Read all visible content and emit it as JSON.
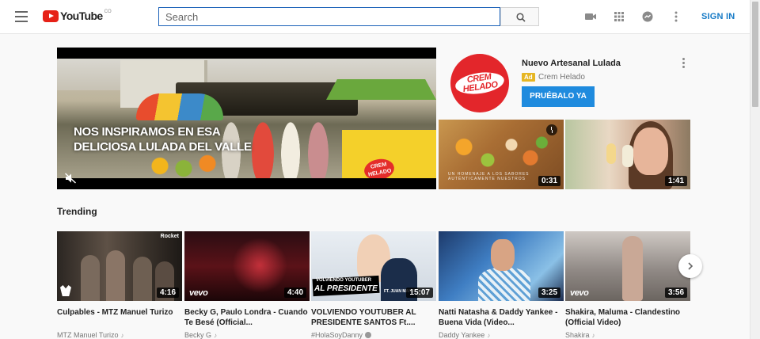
{
  "header": {
    "logo_text": "YouTube",
    "logo_region": "CO",
    "search_placeholder": "Search",
    "sign_in_label": "SIGN IN"
  },
  "hero": {
    "caption_line1": "NOS INSPIRAMOS EN ESA",
    "caption_line2": "DELICIOSA LULADA DEL VALLE",
    "brand_mark": "CREM HELADO"
  },
  "ad": {
    "logo_text_line1": "CREM",
    "logo_text_line2": "HELADO",
    "title": "Nuevo Artesanal Lulada",
    "badge": "Ad",
    "channel": "Crem Helado",
    "cta_label": "PRUÉBALO YA",
    "thumbs": [
      {
        "duration": "0:31",
        "subtext": "UN HOMENAJE A LOS SABORES AUTÉNTICAMENTE NUESTROS"
      },
      {
        "duration": "1:41"
      }
    ]
  },
  "trending": {
    "title": "Trending",
    "videos": [
      {
        "title": "Culpables - MTZ Manuel Turizo",
        "channel": "MTZ Manuel Turizo",
        "duration": "4:16",
        "music": "♪"
      },
      {
        "title": "Becky G, Paulo Londra - Cuando Te Besé (Official...",
        "channel": "Becky G",
        "duration": "4:40",
        "music": "♪"
      },
      {
        "title": "VOLVIENDO YOUTUBER AL PRESIDENTE SANTOS Ft....",
        "channel": "#HolaSoyDanny",
        "duration": "15:07",
        "banner_top": "VOLVIENDO YOUTUBER",
        "banner_main": "AL PRESIDENTE",
        "banner_ft": "FT. JUAN MANU"
      },
      {
        "title": "Natti Natasha & Daddy Yankee - Buena Vida (Video...",
        "channel": "Daddy Yankee",
        "duration": "3:25",
        "music": "♪"
      },
      {
        "title": "Shakira, Maluma - Clandestino (Official Video)",
        "channel": "Shakira",
        "duration": "3:56",
        "music": "♪"
      }
    ],
    "vevo_label": "vevo",
    "rocket_label": "Rocket"
  },
  "colors": {
    "brand_red": "#e62117",
    "link_blue": "#167ac6",
    "cta_blue": "#1f8bde",
    "ad_yellow": "#e6b623"
  }
}
